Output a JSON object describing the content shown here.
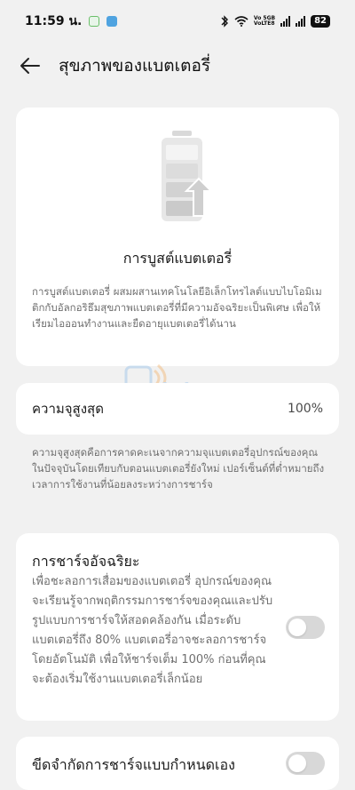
{
  "status_bar": {
    "time": "11:59 น.",
    "net_line1": "Vo 5GB",
    "net_line2": "VoLTE8",
    "battery": "82"
  },
  "header": {
    "title": "สุขภาพของแบตเตอรี่"
  },
  "battery_boost": {
    "title": "การบูสต์แบตเตอรี่",
    "description": "การบูสต์แบตเตอรี่ ผสมผสานเทคโนโลยีอิเล็กโทรไลต์แบบไบโอมิเมติกกับอัลกอริธึมสุขภาพแบตเตอรี่ที่มีความอัจฉริยะเป็นพิเศษ เพื่อให้เรียมไอออนทำงานและยืดอายุแบตเตอรี่ได้นาน"
  },
  "max_capacity": {
    "label": "ความจุสูงสุด",
    "value": "100%",
    "description": "ความจุสูงสุดคือการคาดคะเนจากความจุแบตเตอรี่อุปกรณ์ของคุณในปัจจุบันโดยเทียบกับตอนแบตเตอรี่ยังใหม่ เปอร์เซ็นต์ที่ต่ำหมายถึงเวลาการใช้งานที่น้อยลงระหว่างการชาร์จ"
  },
  "smart_charging": {
    "title": "การชาร์จอัจฉริยะ",
    "description": "เพื่อชะลอการเสื่อมของแบตเตอรี่ อุปกรณ์ของคุณจะเรียนรู้จากพฤติกรรมการชาร์จของคุณและปรับรูปแบบการชาร์จให้สอดคล้องกัน เมื่อระดับแบตเตอรี่ถึง 80% แบตเตอรี่อาจชะลอการชาร์จโดยอัตโนมัติ เพื่อให้ชาร์จเต็ม 100% ก่อนที่คุณจะต้องเริ่มใช้งานแบตเตอรี่เล็กน้อย",
    "enabled": false
  },
  "custom_charging": {
    "title": "ขีดจำกัดการชาร์จแบบกำหนดเอง",
    "enabled": false
  },
  "watermark": {
    "line1": "iPhone",
    "line2": "Droid"
  },
  "colors": {
    "background": "#f1f1f1",
    "card": "#ffffff",
    "muted_text": "#6f6f6f",
    "toggle_off": "#d8d8d8"
  }
}
